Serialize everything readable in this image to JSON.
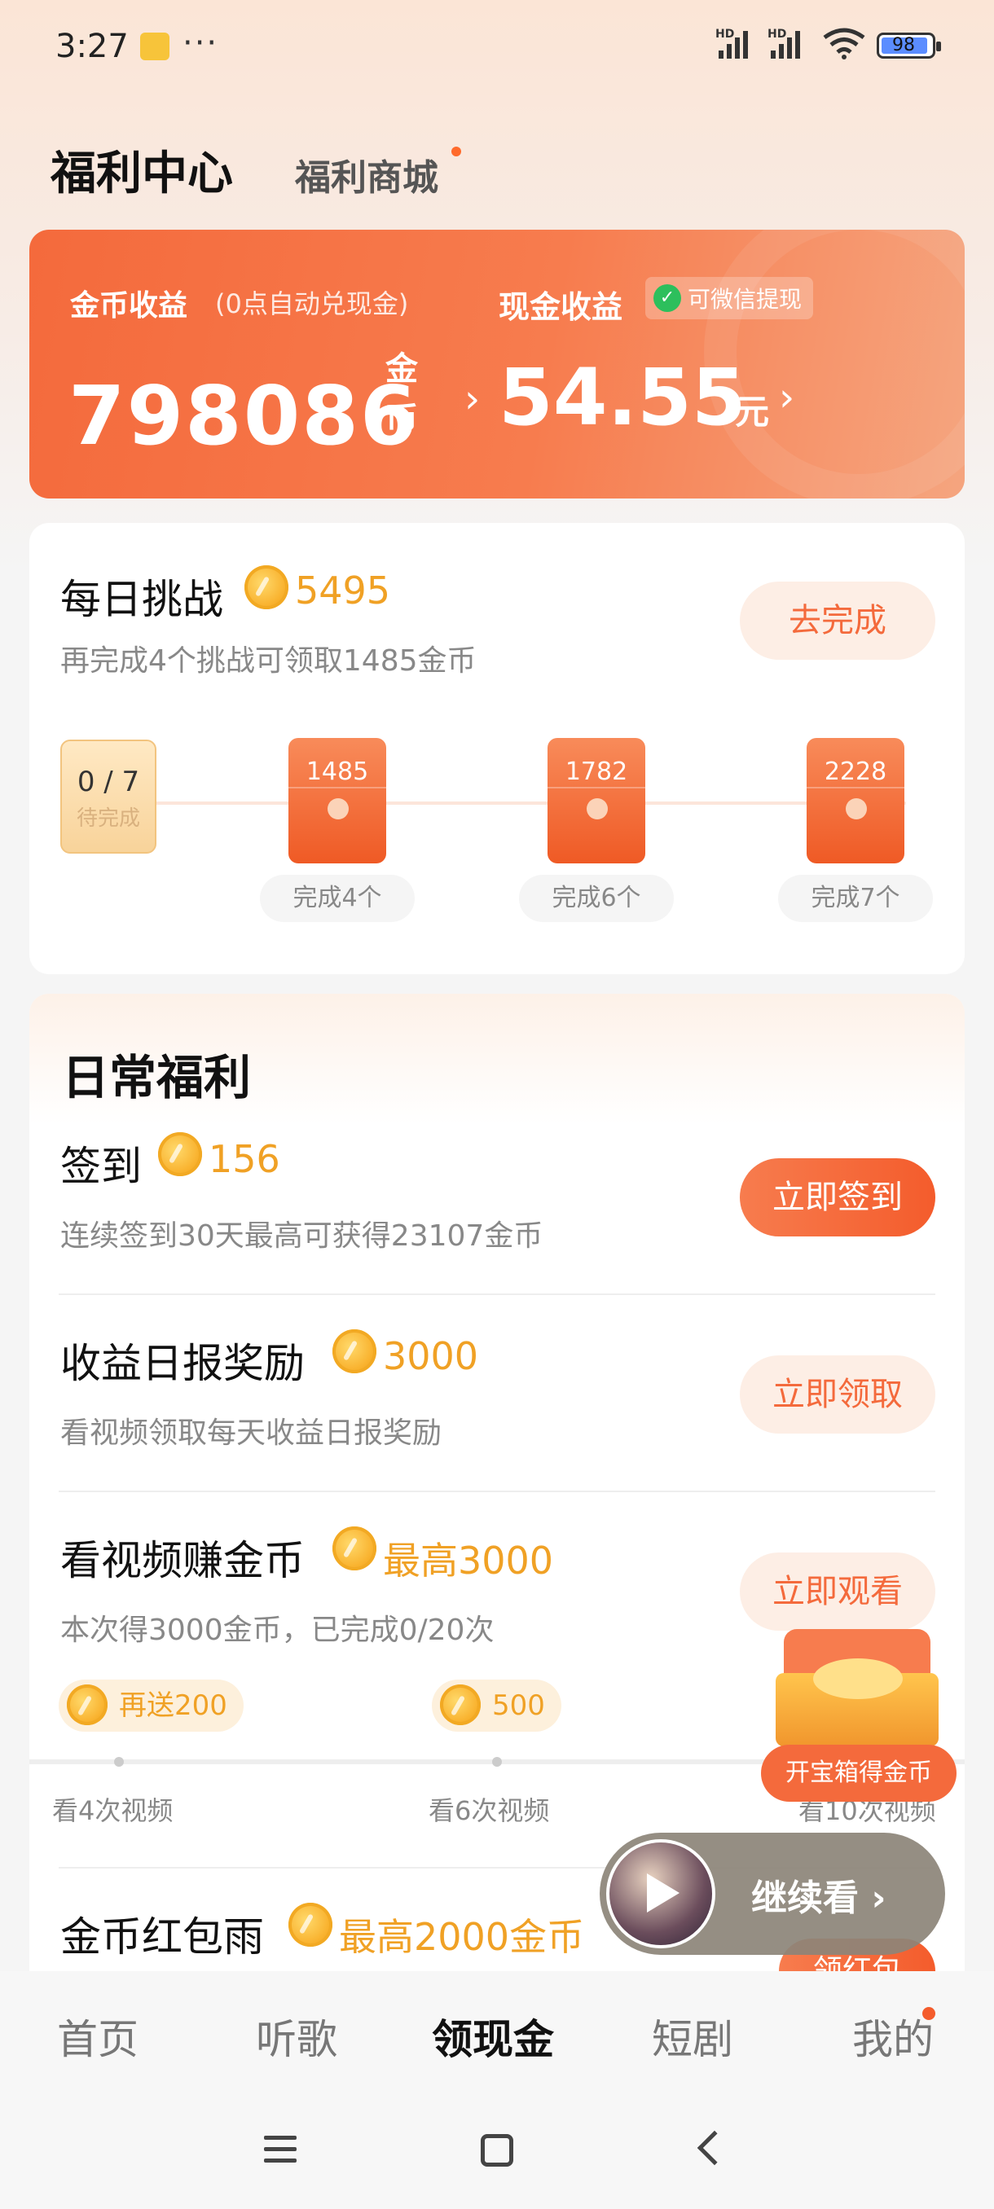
{
  "status": {
    "time": "3:27",
    "dots": "···",
    "battery": "98"
  },
  "header": {
    "title": "福利中心",
    "mall": "福利商城"
  },
  "earnings": {
    "coin_label": "金币收益",
    "coin_note": "(0点自动兑现金)",
    "coins": "798086",
    "coin_unit_1": "金",
    "coin_unit_2": "币",
    "cash_label": "现金收益",
    "wechat": "可微信提现",
    "cash": "54.55",
    "cash_unit": "元"
  },
  "challenge": {
    "title": "每日挑战",
    "amount": "5495",
    "subtitle": "再完成4个挑战可领取1485金币",
    "button": "去完成",
    "progress": "0 / 7",
    "progress_status": "待完成",
    "rewards": [
      {
        "value": "1485",
        "label": "完成4个"
      },
      {
        "value": "1782",
        "label": "完成6个"
      },
      {
        "value": "2228",
        "label": "完成7个"
      }
    ]
  },
  "daily": {
    "title": "日常福利",
    "items": [
      {
        "title": "签到",
        "amount": "156",
        "subtitle": "连续签到30天最高可获得23107金币",
        "button": "立即签到"
      },
      {
        "title": "收益日报奖励",
        "amount": "3000",
        "subtitle": "看视频领取每天收益日报奖励",
        "button": "立即领取"
      },
      {
        "title": "看视频赚金币",
        "amount": "最高3000",
        "subtitle": "本次得3000金币，已完成0/20次",
        "button": "立即观看"
      },
      {
        "title": "金币红包雨",
        "amount": "最高2000金币",
        "button": "领红包"
      }
    ],
    "milestones": [
      {
        "pill": "再送200",
        "label": "看4次视频"
      },
      {
        "pill": "500",
        "label": "看6次视频"
      },
      {
        "label": "看10次视频"
      }
    ],
    "chest_label": "开宝箱得金币",
    "continue_label": "继续看 ›"
  },
  "tabs": [
    "首页",
    "听歌",
    "领现金",
    "短剧",
    "我的"
  ],
  "active_tab": "领现金"
}
